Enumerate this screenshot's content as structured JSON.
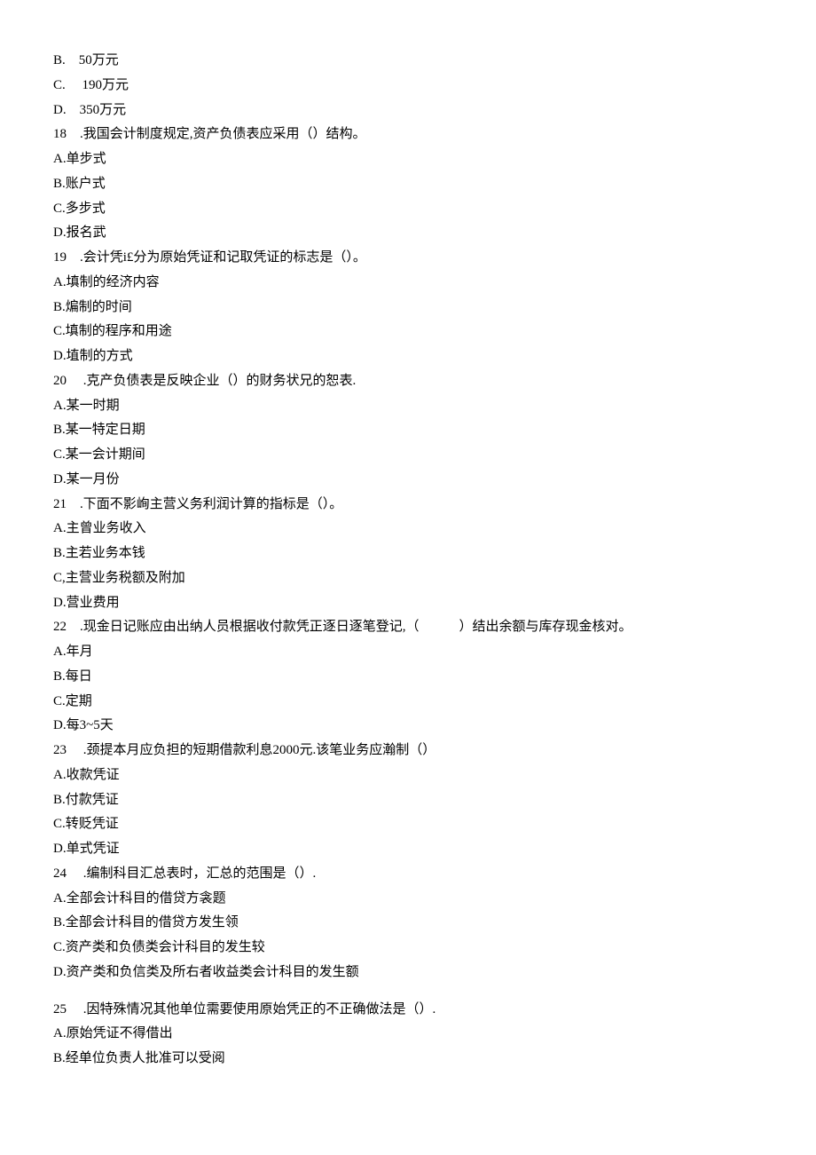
{
  "lines": [
    "B.　50万元",
    "C.　 190万元",
    "D.　350万元",
    "18　.我国会计制度规定,资产负债表应采用（）结构。",
    "A.单步式",
    "B.账户式",
    "C.多步式",
    "D.报名武",
    "19　.会计凭i£分为原始凭证和记取凭证的标志是（）。",
    "A.填制的经济内容",
    "B.煸制的时间",
    "C.填制的程序和用途",
    "D.埴制的方式",
    "20　 .克产负债表是反映企业（）的财务状兄的恕表.",
    "A.某一时期",
    "B.某一特定日期",
    "C.某一会计期间",
    "D.某一月份",
    "21　.下面不影峋主营义务利润计算的指标是（）。",
    "A.主曾业务收入",
    "B.主若业务本钱",
    "C,主营业务税额及附加",
    "D.营业费用",
    "22　.现金日记账应由出纳人员根据收付款凭正逐日逐笔登记,（　　　）结出余额与库存现金核对。",
    "A.年月",
    "B.每日",
    "C.定期",
    "D.每3~5天",
    "23　 .颈提本月应负担的短期借款利息2000元.该笔业务应瀚制（）",
    "A.收款凭证",
    "B.付款凭证",
    "C.转贬凭证",
    "D.单式凭证",
    "24　 .编制科目汇总表时，汇总的范围是（）.",
    "A.全部会计科目的借贷方衾题",
    "B.全部会计科目的借贷方发生领",
    "C.资产类和负债类会计科目的发生较",
    "D.资产类和负信类及所右者收益类会计科目的发生额",
    "",
    "25　 .因特殊情况其他单位需要使用原始凭正的不正确做法是（）.",
    "A.原始凭证不得借出",
    "B.经单位负责人批准可以受阅"
  ]
}
